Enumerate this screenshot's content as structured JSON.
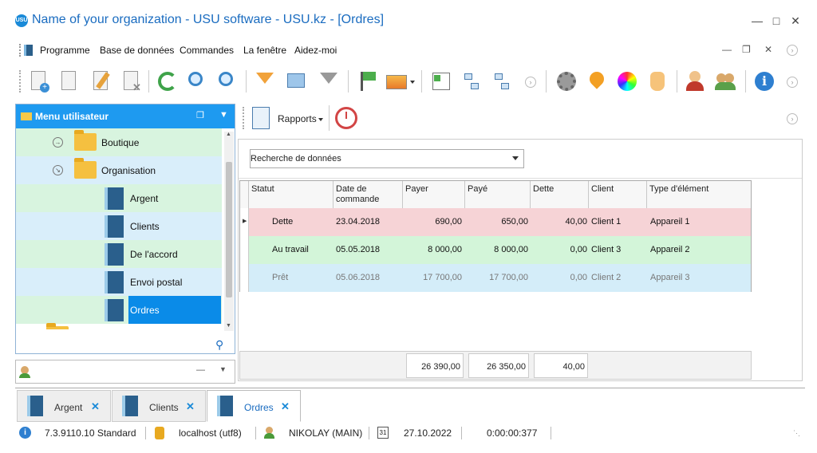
{
  "window": {
    "title": "Name of your organization - USU software - USU.kz - [Ordres]",
    "logo_text": "USU"
  },
  "menu": {
    "items": [
      "Programme",
      "Base de données",
      "Commandes",
      "La fenêtre",
      "Aidez-moi"
    ]
  },
  "left_panel": {
    "title": "Menu utilisateur",
    "tree": [
      {
        "label": "Boutique",
        "type": "folder"
      },
      {
        "label": "Organisation",
        "type": "folder"
      },
      {
        "label": "Argent",
        "type": "module"
      },
      {
        "label": "Clients",
        "type": "module"
      },
      {
        "label": "De l'accord",
        "type": "module"
      },
      {
        "label": "Envoi postal",
        "type": "module"
      },
      {
        "label": "Ordres",
        "type": "module",
        "selected": true
      }
    ]
  },
  "subtoolbar": {
    "rapports_label": "Rapports"
  },
  "search": {
    "value": "Recherche de données"
  },
  "grid": {
    "columns": [
      "Statut",
      "Date de commande",
      "Payer",
      "Payé",
      "Dette",
      "Client",
      "Type d'élément"
    ],
    "rows": [
      {
        "statut": "Dette",
        "date": "23.04.2018",
        "payer": "690,00",
        "paye": "650,00",
        "dette": "40,00",
        "client": "Client 1",
        "type": "Appareil 1",
        "color": "#f6d3d6"
      },
      {
        "statut": "Au travail",
        "date": "05.05.2018",
        "payer": "8 000,00",
        "paye": "8 000,00",
        "dette": "0,00",
        "client": "Client 3",
        "type": "Appareil 2",
        "color": "#d3f5d9"
      },
      {
        "statut": "Prêt",
        "date": "05.06.2018",
        "payer": "17 700,00",
        "paye": "17 700,00",
        "dette": "0,00",
        "client": "Client 2",
        "type": "Appareil 3",
        "color": "#d4edf9"
      }
    ],
    "totals": {
      "payer": "26 390,00",
      "paye": "26 350,00",
      "dette": "40,00"
    }
  },
  "doc_tabs": [
    {
      "label": "Argent",
      "active": false
    },
    {
      "label": "Clients",
      "active": false
    },
    {
      "label": "Ordres",
      "active": true
    }
  ],
  "statusbar": {
    "version": "7.3.9110.10 Standard",
    "db": "localhost (utf8)",
    "user": "NIKOLAY (MAIN)",
    "calendar_day": "31",
    "date": "27.10.2022",
    "timer": "0:00:00:377"
  },
  "colors": {
    "accent": "#1e9af0",
    "selection": "#0a8be8",
    "title": "#1a6cc0"
  }
}
